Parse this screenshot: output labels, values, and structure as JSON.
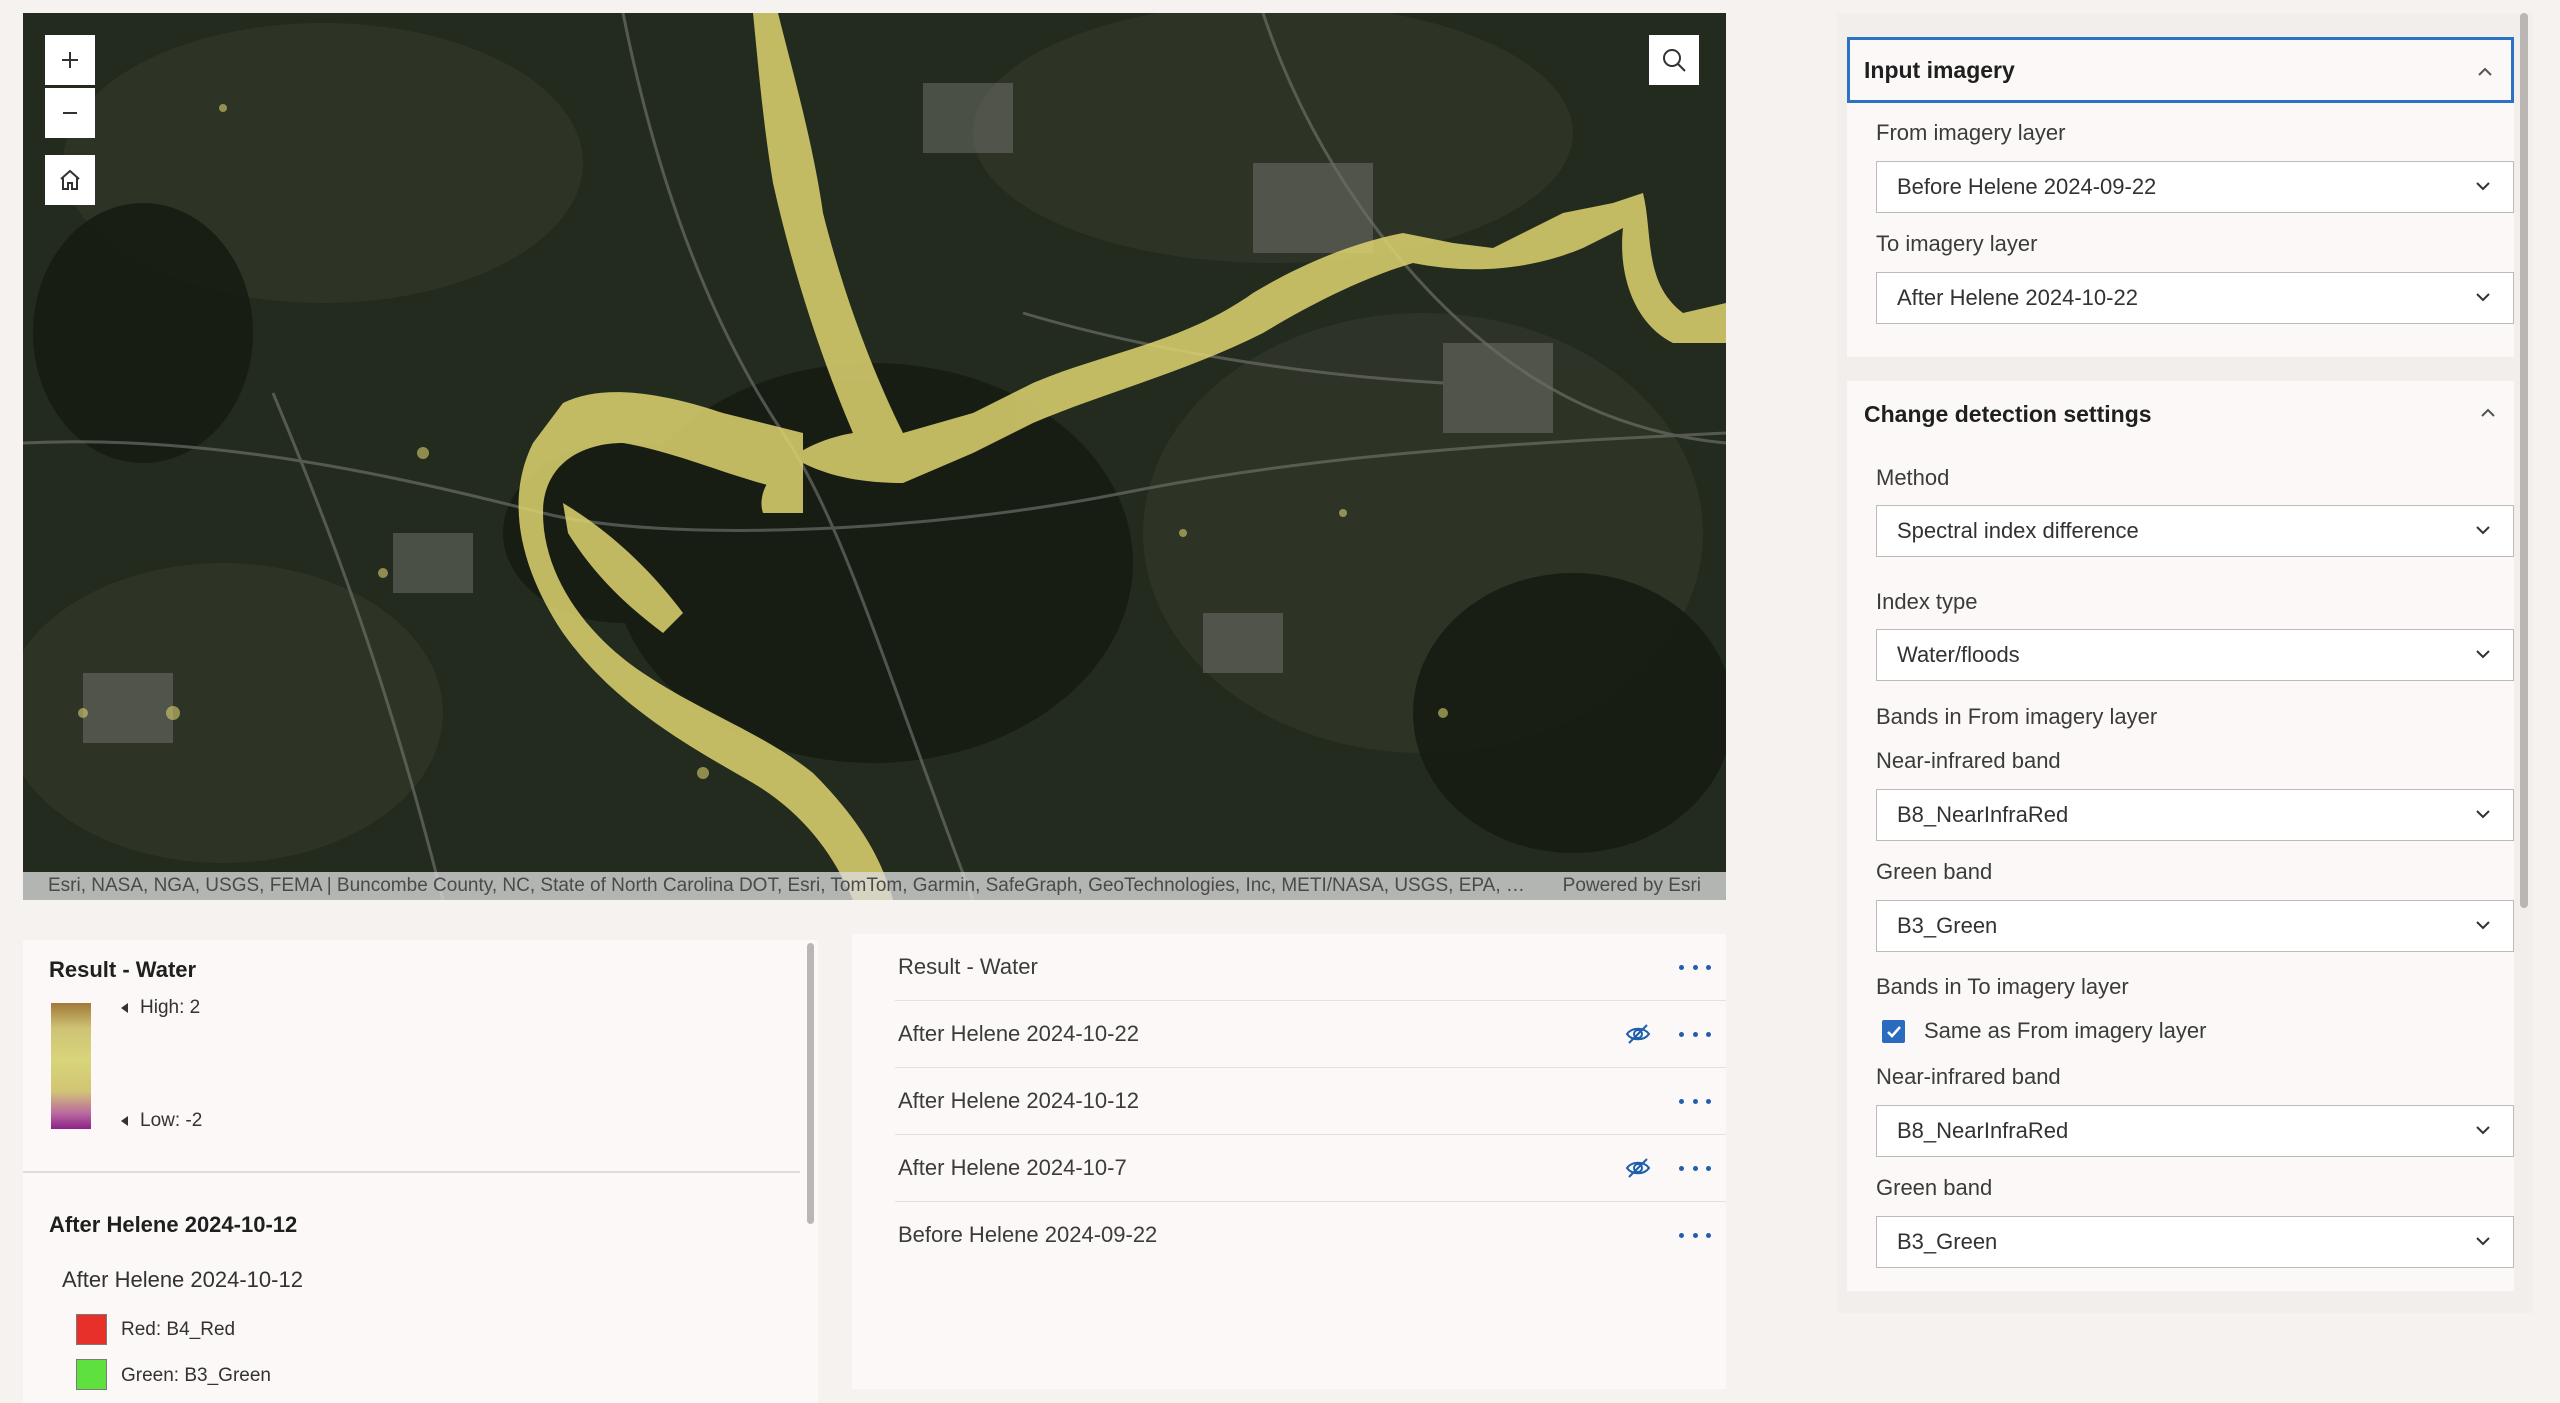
{
  "map": {
    "attribution": "Esri, NASA, NGA, USGS, FEMA | Buncombe County, NC, State of North Carolina DOT, Esri, TomTom, Garmin, SafeGraph, GeoTechnologies, Inc, METI/NASA, USGS, EPA, …",
    "powered_by": "Powered by Esri",
    "zoom_in_icon": "plus-icon",
    "zoom_out_icon": "minus-icon",
    "home_icon": "home-icon",
    "search_icon": "search-icon",
    "flood_color": "#d9cf6e"
  },
  "legend": {
    "result_title": "Result - Water",
    "high_label": "High: 2",
    "low_label": "Low: -2",
    "layer_title": "After Helene 2024-10-12",
    "layer_subtitle": "After Helene 2024-10-12",
    "bands": [
      {
        "label": "Red: B4_Red",
        "color": "#e8302a"
      },
      {
        "label": "Green: B3_Green",
        "color": "#5ee13f"
      }
    ]
  },
  "layers": [
    {
      "name": "Result - Water",
      "hidden": false
    },
    {
      "name": "After Helene 2024-10-22",
      "hidden": true
    },
    {
      "name": "After Helene 2024-10-12",
      "hidden": false
    },
    {
      "name": "After Helene 2024-10-7",
      "hidden": true
    },
    {
      "name": "Before Helene 2024-09-22",
      "hidden": false
    }
  ],
  "panel": {
    "input_imagery": {
      "title": "Input imagery",
      "from_label": "From imagery layer",
      "from_value": "Before Helene 2024-09-22",
      "to_label": "To imagery layer",
      "to_value": "After Helene 2024-10-22"
    },
    "change_detection": {
      "title": "Change detection settings",
      "method_label": "Method",
      "method_value": "Spectral index difference",
      "index_label": "Index type",
      "index_value": "Water/floods",
      "bands_from_label": "Bands in From imagery layer",
      "nir_label_1": "Near-infrared band",
      "nir_value_1": "B8_NearInfraRed",
      "green_label_1": "Green band",
      "green_value_1": "B3_Green",
      "bands_to_label": "Bands in To imagery layer",
      "same_as_label": "Same as From imagery layer",
      "same_as_checked": true,
      "nir_label_2": "Near-infrared band",
      "nir_value_2": "B8_NearInfraRed",
      "green_label_2": "Green band",
      "green_value_2": "B3_Green"
    },
    "accent_color": "#2b72c7"
  }
}
